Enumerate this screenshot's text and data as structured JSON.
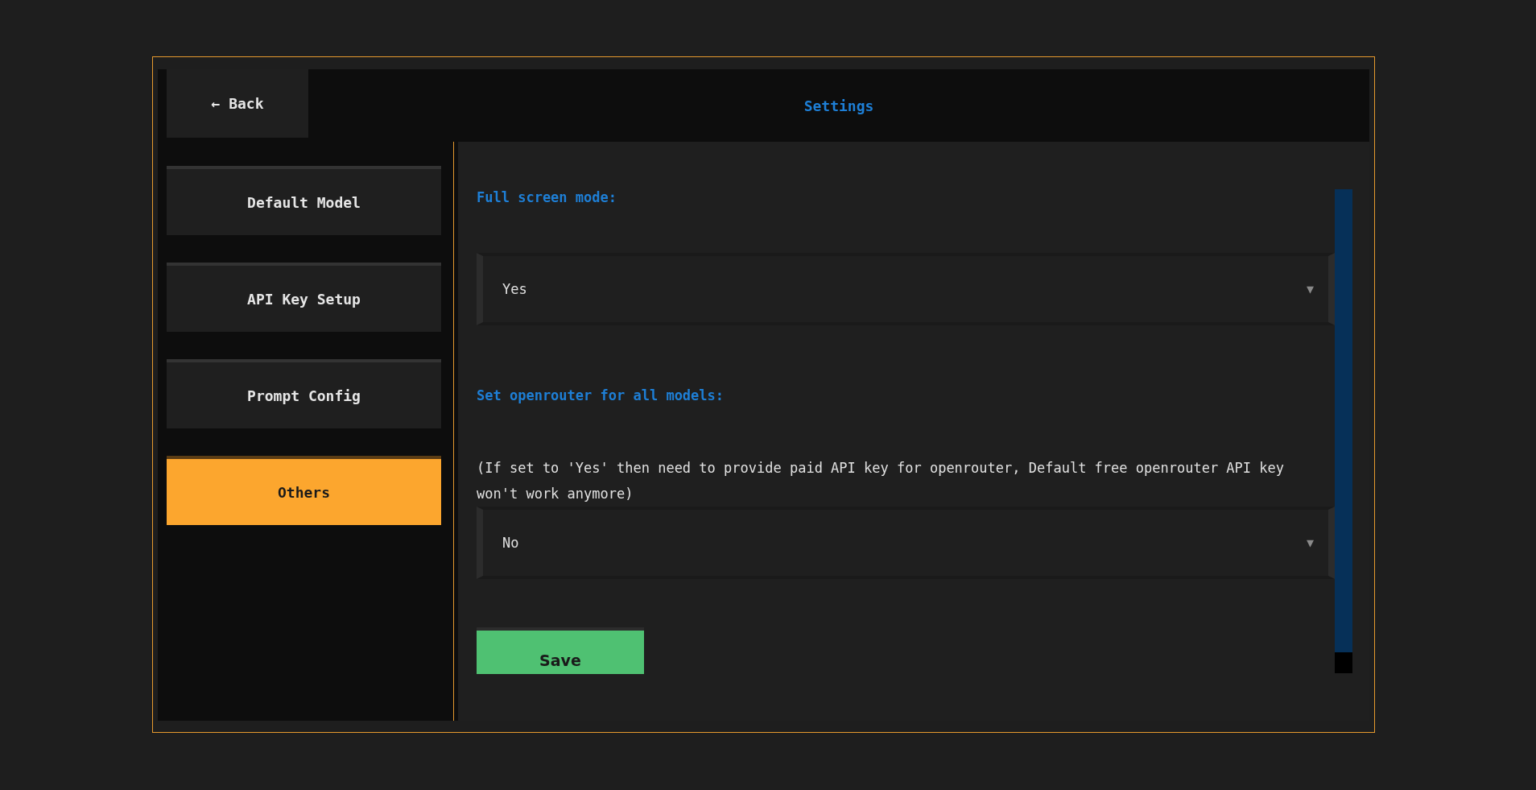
{
  "header": {
    "back_button": "← Back",
    "title": "Settings"
  },
  "sidebar": {
    "items": [
      {
        "label": "Default Model",
        "selected": false
      },
      {
        "label": "API Key Setup",
        "selected": false
      },
      {
        "label": "Prompt Config",
        "selected": false
      },
      {
        "label": "Others",
        "selected": true
      }
    ]
  },
  "settings": [
    {
      "label": "Full screen mode:",
      "value": "Yes",
      "arrow": "▼"
    },
    {
      "label": "Set openrouter for all models:",
      "note": "(If set to 'Yes' then need to provide paid API key for openrouter, Default free openrouter API key won't work anymore)",
      "value": "No",
      "arrow": "▼"
    }
  ],
  "save_button": "Save"
}
